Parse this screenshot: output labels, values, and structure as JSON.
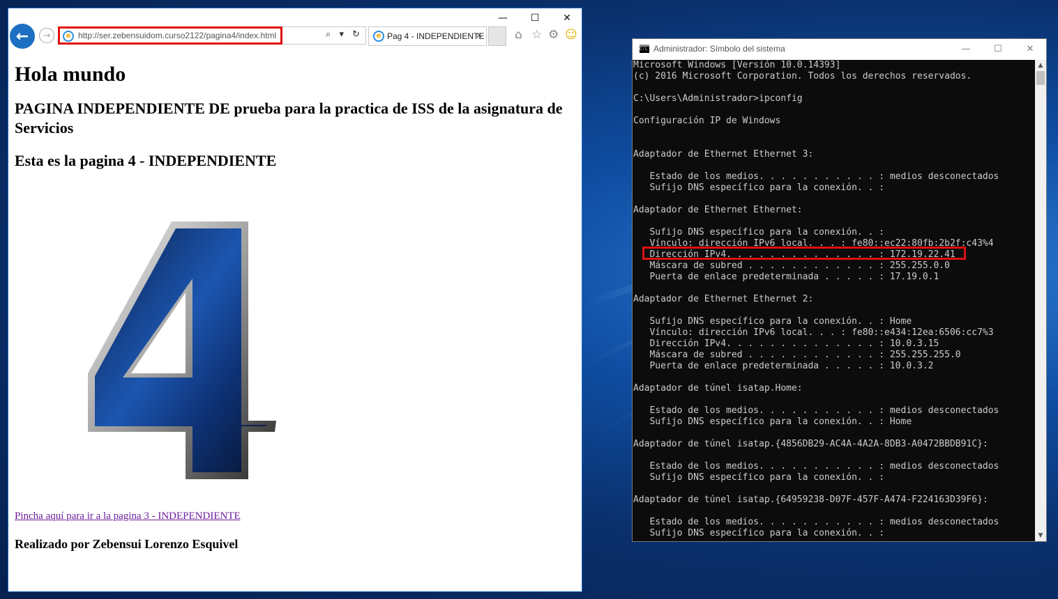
{
  "browser": {
    "url": "http://ser.zebensuidom.curso2122/pagina4/index.html",
    "tab_title": "Pag 4 - INDEPENDIENTE",
    "minimize": "—",
    "maximize": "☐",
    "close": "✕",
    "addr_icons": "⌕ ▾ ↻",
    "highlight_color": "#e01010"
  },
  "page": {
    "h1": "Hola mundo",
    "h2": "PAGINA INDEPENDIENTE DE prueba para la practica de ISS de la asignatura de Servicios",
    "h2b": "Esta es la pagina 4 - INDEPENDIENTE",
    "image_digit": "4",
    "link": "Pincha aquí para ir a la pagina 3 - INDEPENDIENTE",
    "author": "Realizado por Zebensui Lorenzo Esquivel"
  },
  "cmd": {
    "title": "Administrador: Símbolo del sistema",
    "minimize": "—",
    "maximize": "☐",
    "close": "✕",
    "lines": [
      "Microsoft Windows [Versión 10.0.14393]",
      "(c) 2016 Microsoft Corporation. Todos los derechos reservados.",
      "",
      "C:\\Users\\Administrador>ipconfig",
      "",
      "Configuración IP de Windows",
      "",
      "",
      "Adaptador de Ethernet Ethernet 3:",
      "",
      "   Estado de los medios. . . . . . . . . . . : medios desconectados",
      "   Sufijo DNS específico para la conexión. . :",
      "",
      "Adaptador de Ethernet Ethernet:",
      "",
      "   Sufijo DNS específico para la conexión. . :",
      "   Vínculo: dirección IPv6 local. . . : fe80::ec22:80fb:2b2f:c43%4",
      "   Dirección IPv4. . . . . . . . . . . . . . : 172.19.22.41",
      "   Máscara de subred . . . . . . . . . . . . : 255.255.0.0",
      "   Puerta de enlace predeterminada . . . . . : 17.19.0.1",
      "",
      "Adaptador de Ethernet Ethernet 2:",
      "",
      "   Sufijo DNS específico para la conexión. . : Home",
      "   Vínculo: dirección IPv6 local. . . : fe80::e434:12ea:6506:cc7%3",
      "   Dirección IPv4. . . . . . . . . . . . . . : 10.0.3.15",
      "   Máscara de subred . . . . . . . . . . . . : 255.255.255.0",
      "   Puerta de enlace predeterminada . . . . . : 10.0.3.2",
      "",
      "Adaptador de túnel isatap.Home:",
      "",
      "   Estado de los medios. . . . . . . . . . . : medios desconectados",
      "   Sufijo DNS específico para la conexión. . : Home",
      "",
      "Adaptador de túnel isatap.{4856DB29-AC4A-4A2A-8DB3-A0472BBDB91C}:",
      "",
      "   Estado de los medios. . . . . . . . . . . : medios desconectados",
      "   Sufijo DNS específico para la conexión. . :",
      "",
      "Adaptador de túnel isatap.{64959238-D07F-457F-A474-F224163D39F6}:",
      "",
      "   Estado de los medios. . . . . . . . . . . : medios desconectados",
      "   Sufijo DNS específico para la conexión. . :"
    ]
  }
}
